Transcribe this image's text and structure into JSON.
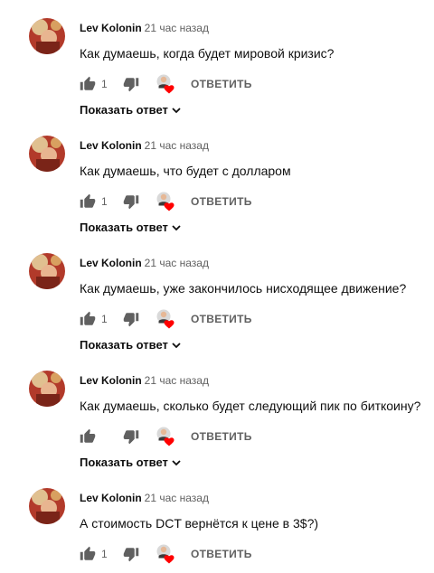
{
  "comments": [
    {
      "author": "Lev Kolonin",
      "time": "21 час назад",
      "text": "Как думаешь, когда будет мировой кризис?",
      "likes": "1",
      "reply_label": "ОТВЕТИТЬ",
      "show_replies_label": "Показать ответ"
    },
    {
      "author": "Lev Kolonin",
      "time": "21 час назад",
      "text": "Как думаешь, что будет с долларом",
      "likes": "1",
      "reply_label": "ОТВЕТИТЬ",
      "show_replies_label": "Показать ответ"
    },
    {
      "author": "Lev Kolonin",
      "time": "21 час назад",
      "text": "Как думаешь, уже закончилось нисходящее движение?",
      "likes": "1",
      "reply_label": "ОТВЕТИТЬ",
      "show_replies_label": "Показать ответ"
    },
    {
      "author": "Lev Kolonin",
      "time": "21 час назад",
      "text": "Как думаешь, сколько будет следующий пик по биткоину?",
      "likes": "",
      "reply_label": "ОТВЕТИТЬ",
      "show_replies_label": "Показать ответ"
    },
    {
      "author": "Lev Kolonin",
      "time": "21 час назад",
      "text": "А стоимость DCT вернётся к цене в 3$?)",
      "likes": "1",
      "reply_label": "ОТВЕТИТЬ",
      "show_replies_label": ""
    }
  ],
  "colors": {
    "text": "#0f0f0f",
    "secondary": "#606060",
    "heart": "#ff0000"
  },
  "icons": {
    "like": "thumb-up-icon",
    "dislike": "thumb-down-icon",
    "creator_heart": "creator-heart-icon",
    "expand": "chevron-down-icon"
  }
}
